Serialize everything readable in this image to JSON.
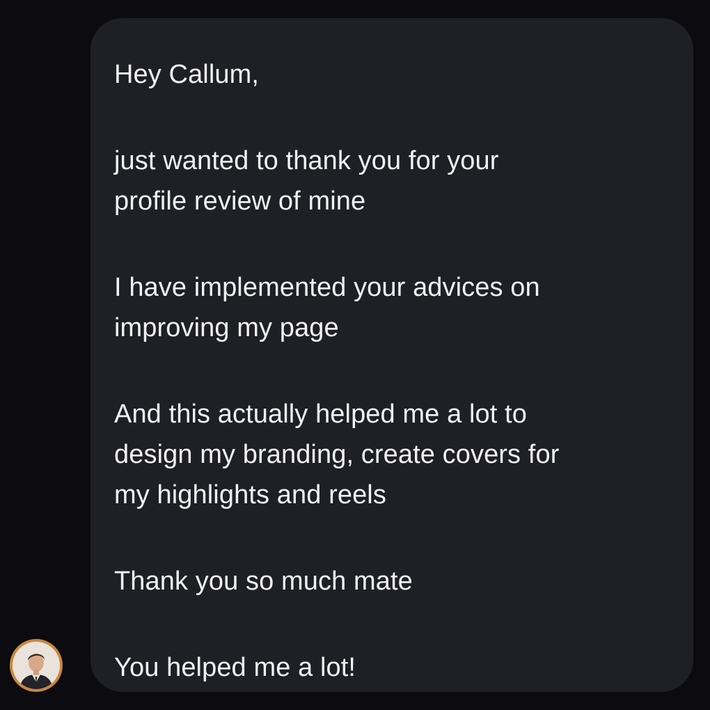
{
  "message": {
    "greeting": "Hey Callum,",
    "paragraphs": [
      [
        "just wanted to thank you for your",
        "profile review of mine"
      ],
      [
        "I have implemented your advices on",
        "improving my page"
      ],
      [
        "And this actually helped me a lot to",
        "design my branding, create covers for",
        "my highlights and reels"
      ],
      [
        "Thank you so much mate"
      ],
      [
        "You helped me a lot!"
      ]
    ]
  },
  "sender": {
    "avatar_icon": "person-avatar",
    "avatar_ring_color": "#c9873f"
  },
  "colors": {
    "background": "#0b0b10",
    "bubble": "#1f1f26",
    "text": "#f2f2f4"
  }
}
